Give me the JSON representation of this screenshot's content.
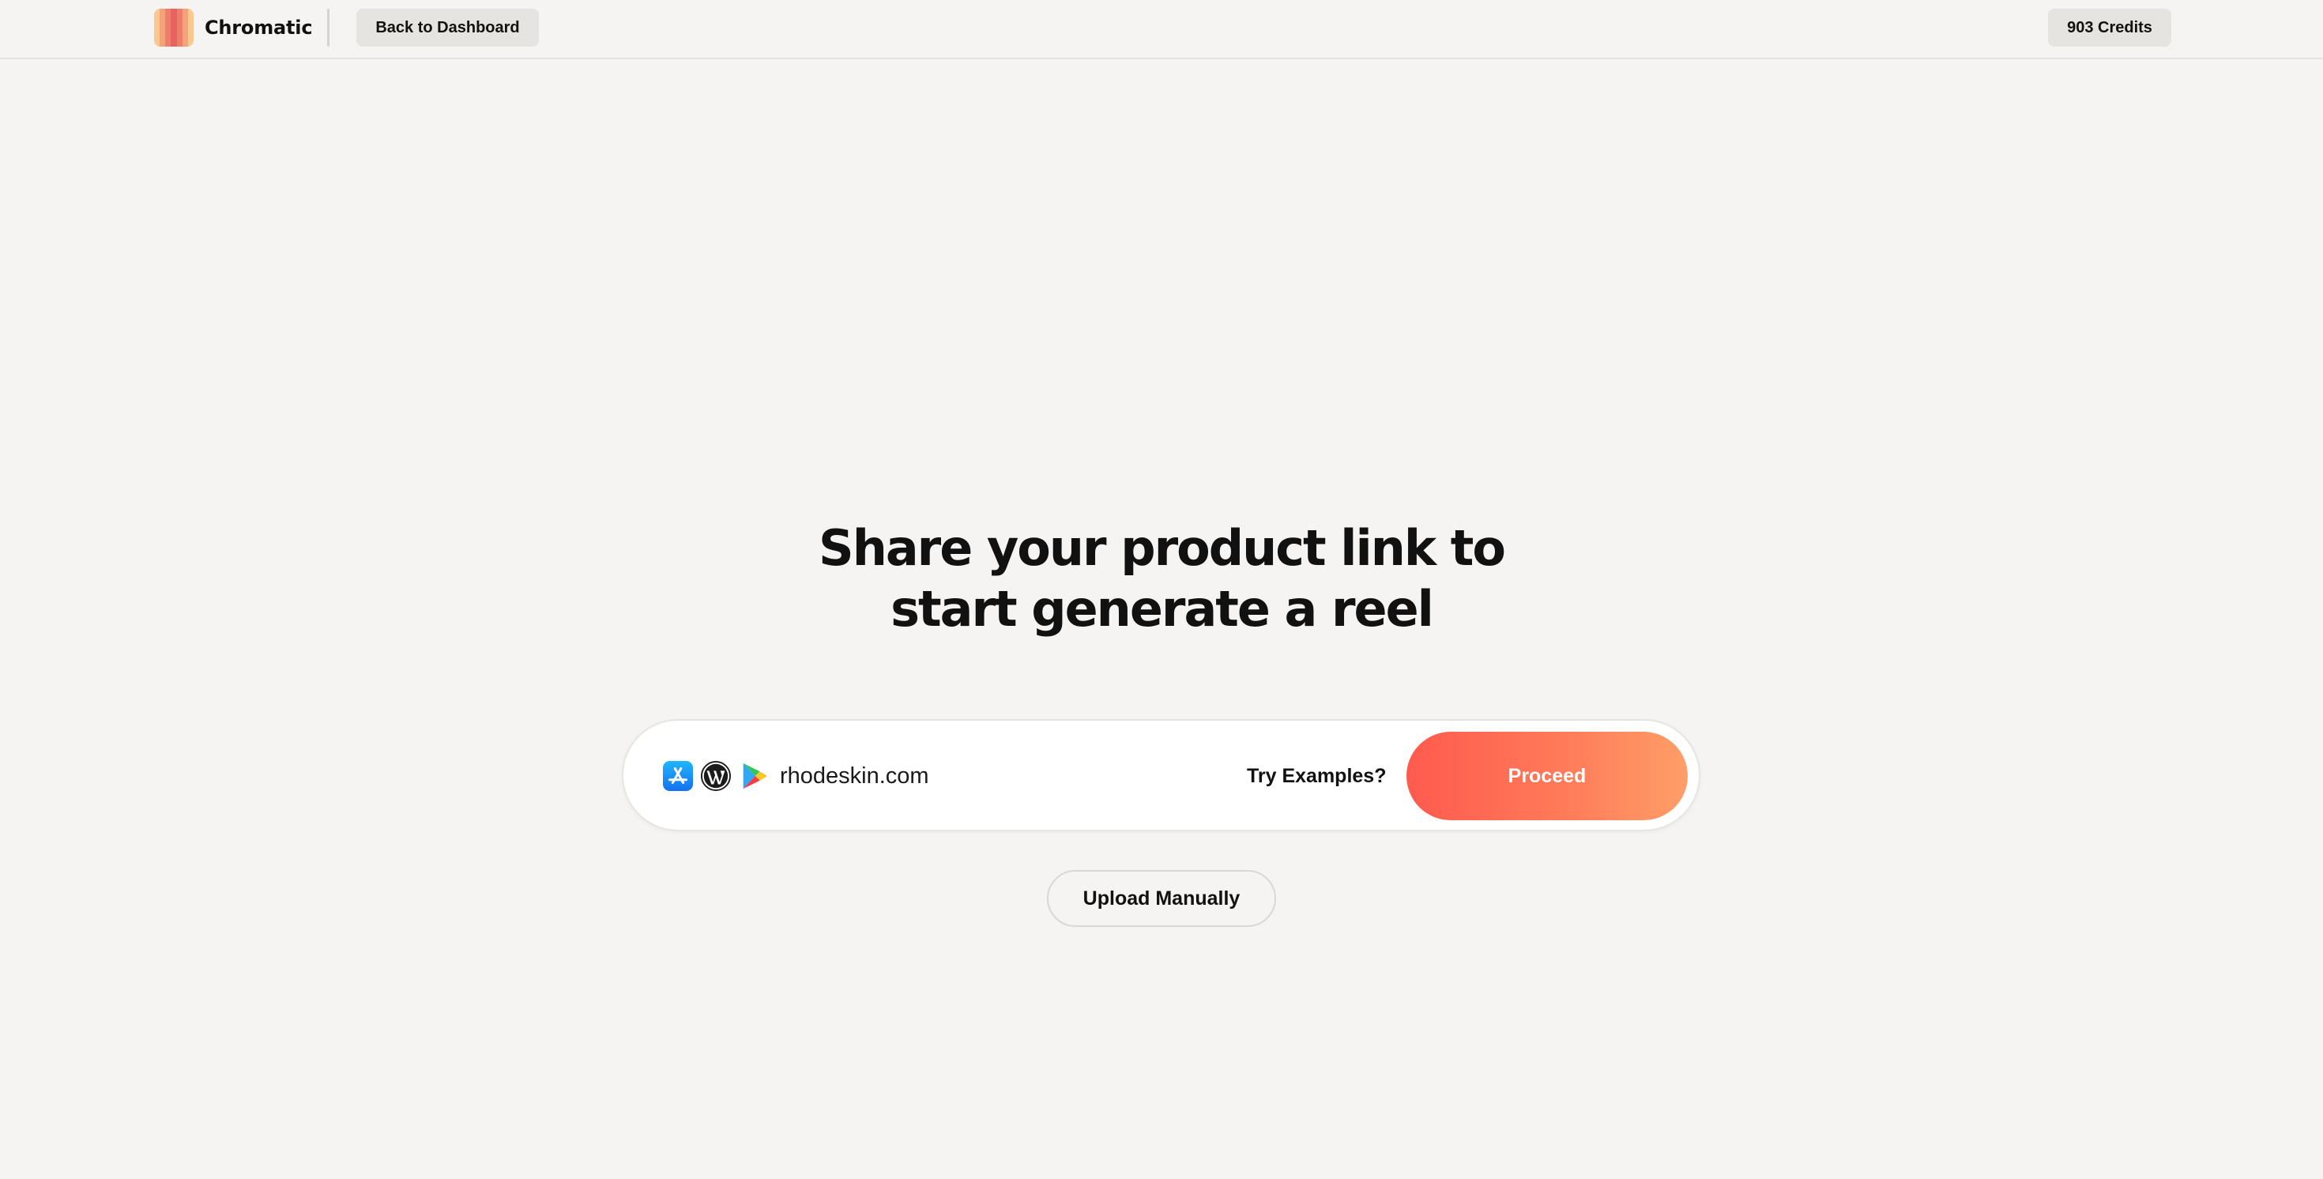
{
  "app": {
    "brand": "Chromatic",
    "logo_icon": "chromatic-logo-icon",
    "logo_colors": [
      "#f9c88f",
      "#f4a27a",
      "#ef7d6b",
      "#e9625f",
      "#ef7d6b",
      "#f4a27a",
      "#f9c88f"
    ]
  },
  "header": {
    "back_label": "Back to Dashboard",
    "credits_label": "903 Credits"
  },
  "main": {
    "headline_line1": "Share your product link to",
    "headline_line2": "start generate a reel",
    "link_bar": {
      "icons": [
        "app-store-icon",
        "wordpress-icon",
        "google-play-icon"
      ],
      "input_value": "rhodeskin.com",
      "try_examples_label": "Try Examples?",
      "proceed_label": "Proceed"
    },
    "upload_label": "Upload Manually"
  },
  "colors": {
    "background": "#f5f4f2",
    "accent_start": "#ff5a4f",
    "accent_end": "#ff9e68",
    "app_store_blue": "#1a8cf5"
  }
}
